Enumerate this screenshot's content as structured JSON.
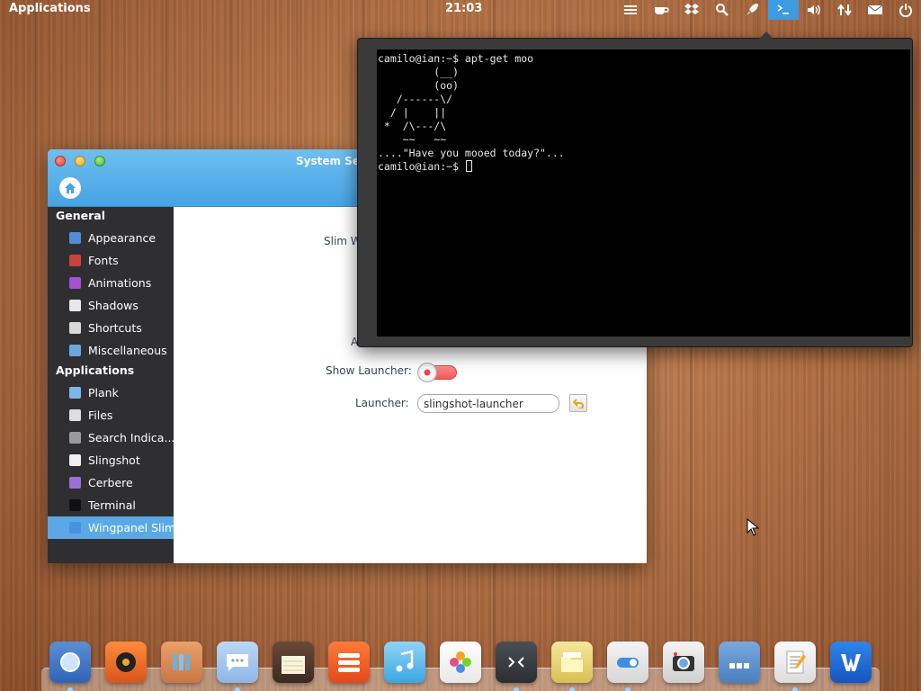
{
  "panel": {
    "applications_label": "Applications",
    "clock": "21:03",
    "indicators": [
      "menu-icon",
      "coffee-cup-icon",
      "dropbox-icon",
      "search-icon",
      "rocket-icon",
      "terminal-icon",
      "volume-icon",
      "network-icon",
      "mail-icon",
      "power-icon"
    ]
  },
  "settings_window": {
    "title": "System Set",
    "sidebar": {
      "general_header": "General",
      "general_items": [
        {
          "label": "Appearance",
          "icon": "appearance-icon",
          "color": "#4f8fd8"
        },
        {
          "label": "Fonts",
          "icon": "fonts-icon",
          "color": "#c9433b"
        },
        {
          "label": "Animations",
          "icon": "animations-icon",
          "color": "#a64fd6"
        },
        {
          "label": "Shadows",
          "icon": "shadows-icon",
          "color": "#e8e8e8"
        },
        {
          "label": "Shortcuts",
          "icon": "shortcuts-icon",
          "color": "#d9d9d9"
        },
        {
          "label": "Miscellaneous",
          "icon": "miscellaneous-icon",
          "color": "#6aa8e0"
        }
      ],
      "applications_header": "Applications",
      "application_items": [
        {
          "label": "Plank",
          "icon": "plank-icon",
          "color": "#7fb5e8"
        },
        {
          "label": "Files",
          "icon": "files-icon",
          "color": "#dedede"
        },
        {
          "label": "Search Indica...",
          "icon": "search-indicator-icon",
          "color": "#9a9a9a"
        },
        {
          "label": "Slingshot",
          "icon": "slingshot-icon",
          "color": "#f0f0f0"
        },
        {
          "label": "Cerbere",
          "icon": "cerbere-icon",
          "color": "#9b6fd6"
        },
        {
          "label": "Terminal",
          "icon": "terminal-icon",
          "color": "#111111"
        },
        {
          "label": "Wingpanel Slim",
          "icon": "wingpanel-icon",
          "color": "#4a90e0"
        }
      ],
      "selected": "Wingpanel Slim"
    },
    "content": {
      "slim_label_partial": "Slim W",
      "auto_label_partial": "A",
      "show_launcher_label": "Show Launcher:",
      "launcher_label": "Launcher:",
      "launcher_value": "slingshot-launcher"
    }
  },
  "terminal": {
    "lines": [
      "camilo@ian:~$ apt-get moo",
      "         (__)",
      "         (oo)",
      "   /------\\/",
      "  / |    ||",
      " *  /\\---/\\",
      "    ~~   ~~",
      "....\"Have you mooed today?\"...",
      "camilo@ian:~$ "
    ]
  },
  "dock": {
    "items": [
      "browser-icon",
      "music-player-icon",
      "library-icon",
      "chat-icon",
      "notes-icon",
      "stack-icon",
      "music-note-icon",
      "photos-icon",
      "terminal-icon",
      "files-folder-icon",
      "settings-toggle-icon",
      "camera-icon",
      "multitasking-icon",
      "text-editor-icon",
      "writer-icon"
    ]
  }
}
